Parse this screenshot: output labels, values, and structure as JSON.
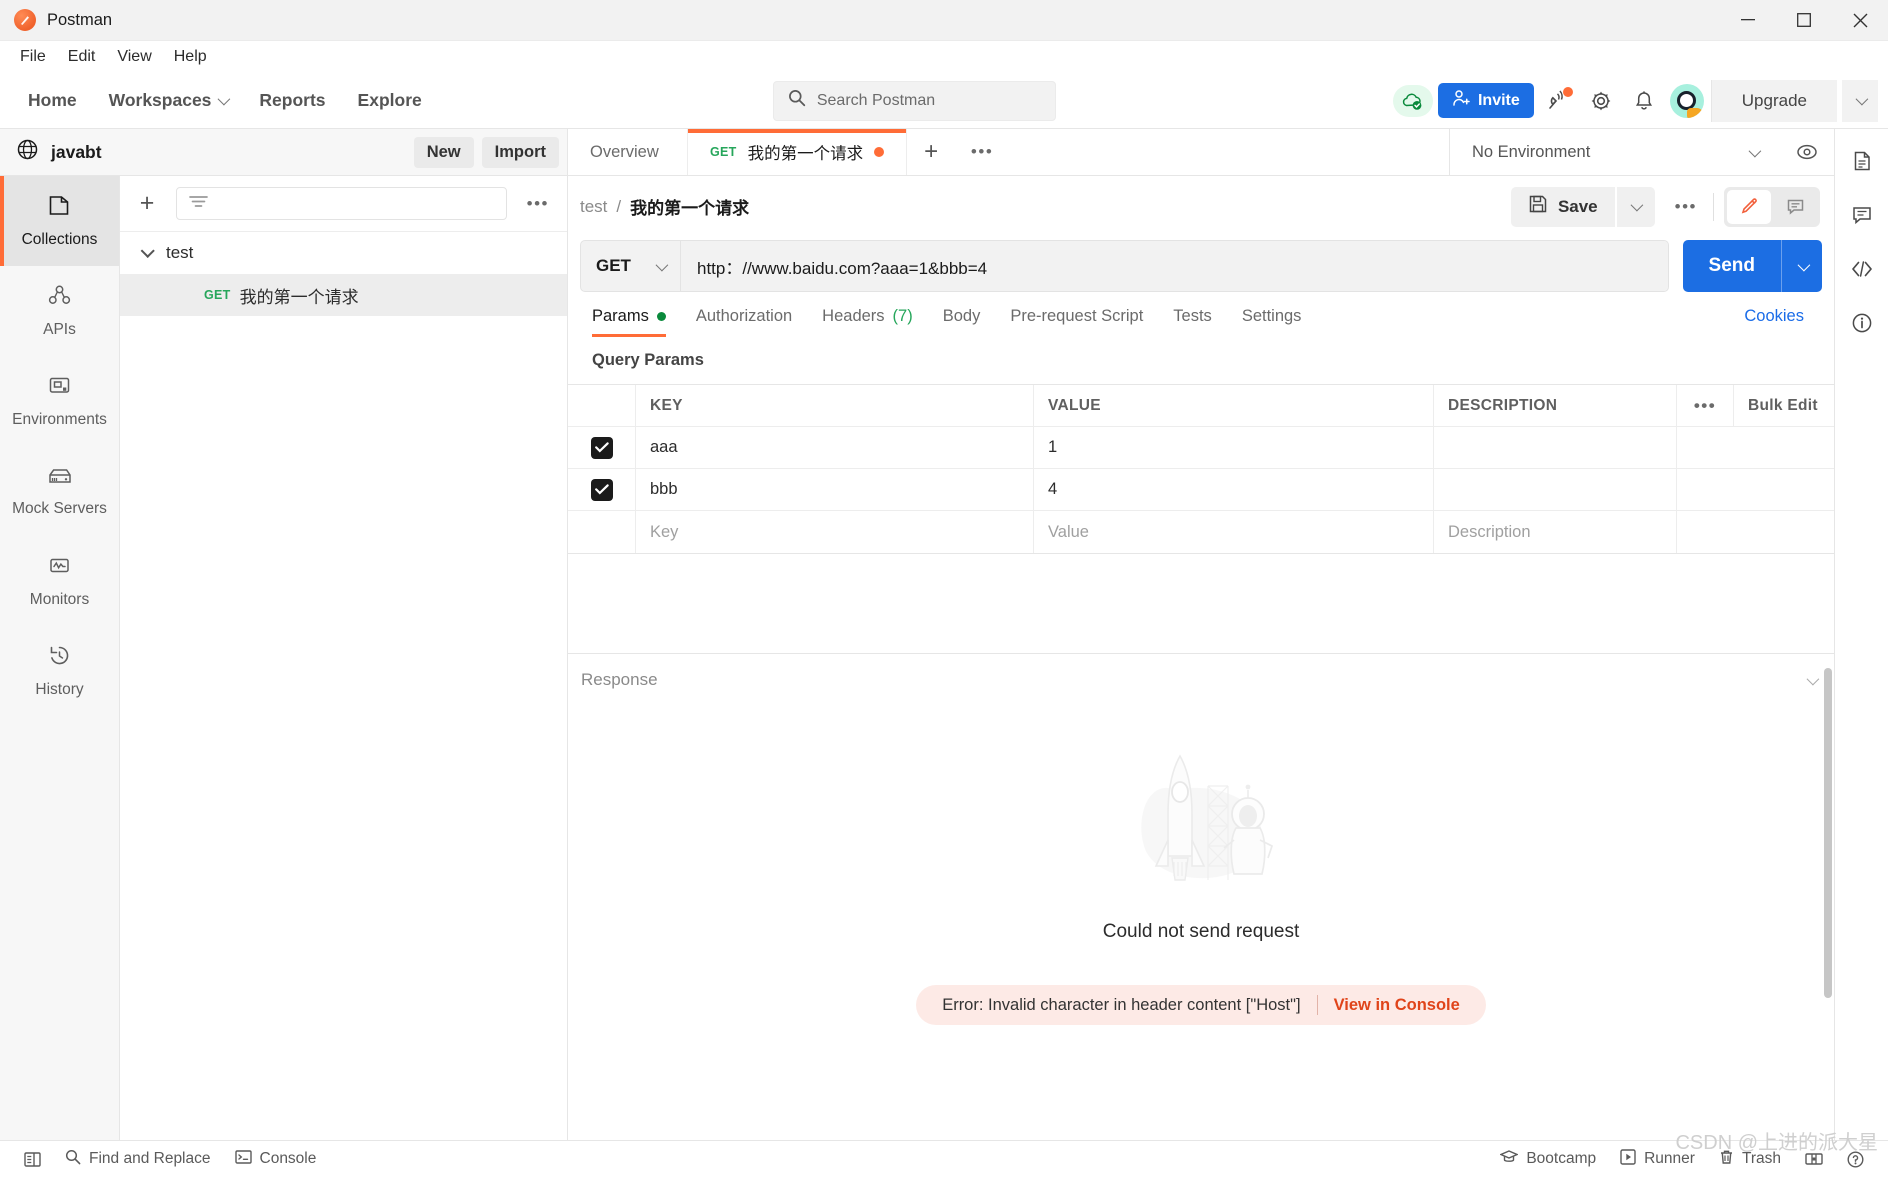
{
  "window": {
    "app_title": "Postman",
    "minimize": "—",
    "maximize": "▢",
    "close": "✕"
  },
  "menubar": {
    "items": [
      "File",
      "Edit",
      "View",
      "Help"
    ]
  },
  "topnav": {
    "links": [
      {
        "label": "Home",
        "has_caret": false
      },
      {
        "label": "Workspaces",
        "has_caret": true
      },
      {
        "label": "Reports",
        "has_caret": false
      },
      {
        "label": "Explore",
        "has_caret": false
      }
    ],
    "search": {
      "placeholder": "Search Postman",
      "value": "",
      "icon": "search-icon"
    },
    "cloud_status_icon": "cloud-check-icon",
    "invite_label": "Invite",
    "invite_icon": "user-plus-icon",
    "icons": [
      "satellite-icon",
      "gear-icon",
      "bell-icon"
    ],
    "has_notification_dot": true,
    "avatar": "user-avatar",
    "upgrade_label": "Upgrade",
    "accent_blue": "#1c6ee3",
    "accent_orange": "#ff6c37"
  },
  "workspace": {
    "name": "javabt",
    "icon": "globe-icon",
    "new_label": "New",
    "import_label": "Import"
  },
  "sidebar": {
    "rail_items": [
      {
        "label": "Collections",
        "icon": "collections-icon",
        "active": true
      },
      {
        "label": "APIs",
        "icon": "apis-icon",
        "active": false
      },
      {
        "label": "Environments",
        "icon": "environments-icon",
        "active": false
      },
      {
        "label": "Mock Servers",
        "icon": "mock-servers-icon",
        "active": false
      },
      {
        "label": "Monitors",
        "icon": "monitors-icon",
        "active": false
      },
      {
        "label": "History",
        "icon": "history-icon",
        "active": false
      }
    ],
    "toolbar": {
      "add_icon": "plus-icon",
      "filter_icon": "filter-icon",
      "more_icon": "more-icon"
    },
    "tree": [
      {
        "type": "collection",
        "label": "test",
        "expanded": true
      },
      {
        "type": "request",
        "method": "GET",
        "label": "我的第一个请求",
        "selected": true
      }
    ]
  },
  "tabstrip": {
    "tabs": [
      {
        "label": "Overview",
        "active": false,
        "method": "",
        "unsaved": false
      },
      {
        "label": "我的第一个请求",
        "active": true,
        "method": "GET",
        "unsaved": true
      }
    ],
    "add_tab_icon": "plus-icon",
    "more_tabs_icon": "more-icon",
    "environment": {
      "selected": "No Environment",
      "chevron": "chevron-down-icon"
    },
    "eye_icon": "eye-icon"
  },
  "request": {
    "breadcrumb": {
      "collection": "test",
      "separator": "/",
      "name": "我的第一个请求"
    },
    "save_label": "Save",
    "save_icon": "floppy-disk-icon",
    "save_chevron": "chevron-down-icon",
    "more_icon": "more-icon",
    "view_toggle": [
      {
        "icon": "pencil-icon",
        "active": true
      },
      {
        "icon": "comment-icon",
        "active": false
      }
    ],
    "method": "GET",
    "url": "http：//www.baidu.com?aaa=1&bbb=4",
    "url_placeholder": "Enter request URL",
    "send_label": "Send",
    "tabs": [
      {
        "label": "Params",
        "active": true,
        "indicator": "dot",
        "count": ""
      },
      {
        "label": "Authorization",
        "active": false,
        "indicator": "",
        "count": ""
      },
      {
        "label": "Headers",
        "active": false,
        "indicator": "",
        "count": "(7)"
      },
      {
        "label": "Body",
        "active": false,
        "indicator": "",
        "count": ""
      },
      {
        "label": "Pre-request Script",
        "active": false,
        "indicator": "",
        "count": ""
      },
      {
        "label": "Tests",
        "active": false,
        "indicator": "",
        "count": ""
      },
      {
        "label": "Settings",
        "active": false,
        "indicator": "",
        "count": ""
      }
    ],
    "cookies_label": "Cookies"
  },
  "query_params": {
    "section_title": "Query Params",
    "columns": [
      "KEY",
      "VALUE",
      "DESCRIPTION"
    ],
    "more_icon": "more-icon",
    "bulk_edit_label": "Bulk Edit",
    "rows": [
      {
        "checked": true,
        "key": "aaa",
        "value": "1",
        "description": ""
      },
      {
        "checked": true,
        "key": "bbb",
        "value": "4",
        "description": ""
      }
    ],
    "new_row_placeholders": {
      "key": "Key",
      "value": "Value",
      "description": "Description"
    }
  },
  "response": {
    "title": "Response",
    "collapse_icon": "chevron-down-icon",
    "empty_illustration": "rocket-astronaut-illustration",
    "headline": "Could not send request",
    "error": {
      "message": "Error: Invalid character in header content [\"Host\"]",
      "action_label": "View in Console",
      "bg_color": "#fdeae6",
      "action_color": "#e0441a"
    }
  },
  "right_rail": {
    "items": [
      {
        "icon": "documentation-icon"
      },
      {
        "icon": "comments-icon"
      },
      {
        "icon": "code-snippet-icon"
      },
      {
        "icon": "info-icon"
      }
    ]
  },
  "statusbar": {
    "left_items": [
      {
        "label": "",
        "icon": "sidebar-toggle-icon"
      },
      {
        "label": "Find and Replace",
        "icon": "search-icon"
      },
      {
        "label": "Console",
        "icon": "terminal-icon"
      }
    ],
    "right_items": [
      {
        "label": "Bootcamp",
        "icon": "graduation-cap-icon"
      },
      {
        "label": "Runner",
        "icon": "play-icon"
      },
      {
        "label": "Trash",
        "icon": "trash-icon"
      },
      {
        "label": "",
        "icon": "panel-layout-icon"
      },
      {
        "label": "",
        "icon": "help-icon"
      }
    ]
  },
  "watermark": "CSDN @上进的派大星"
}
